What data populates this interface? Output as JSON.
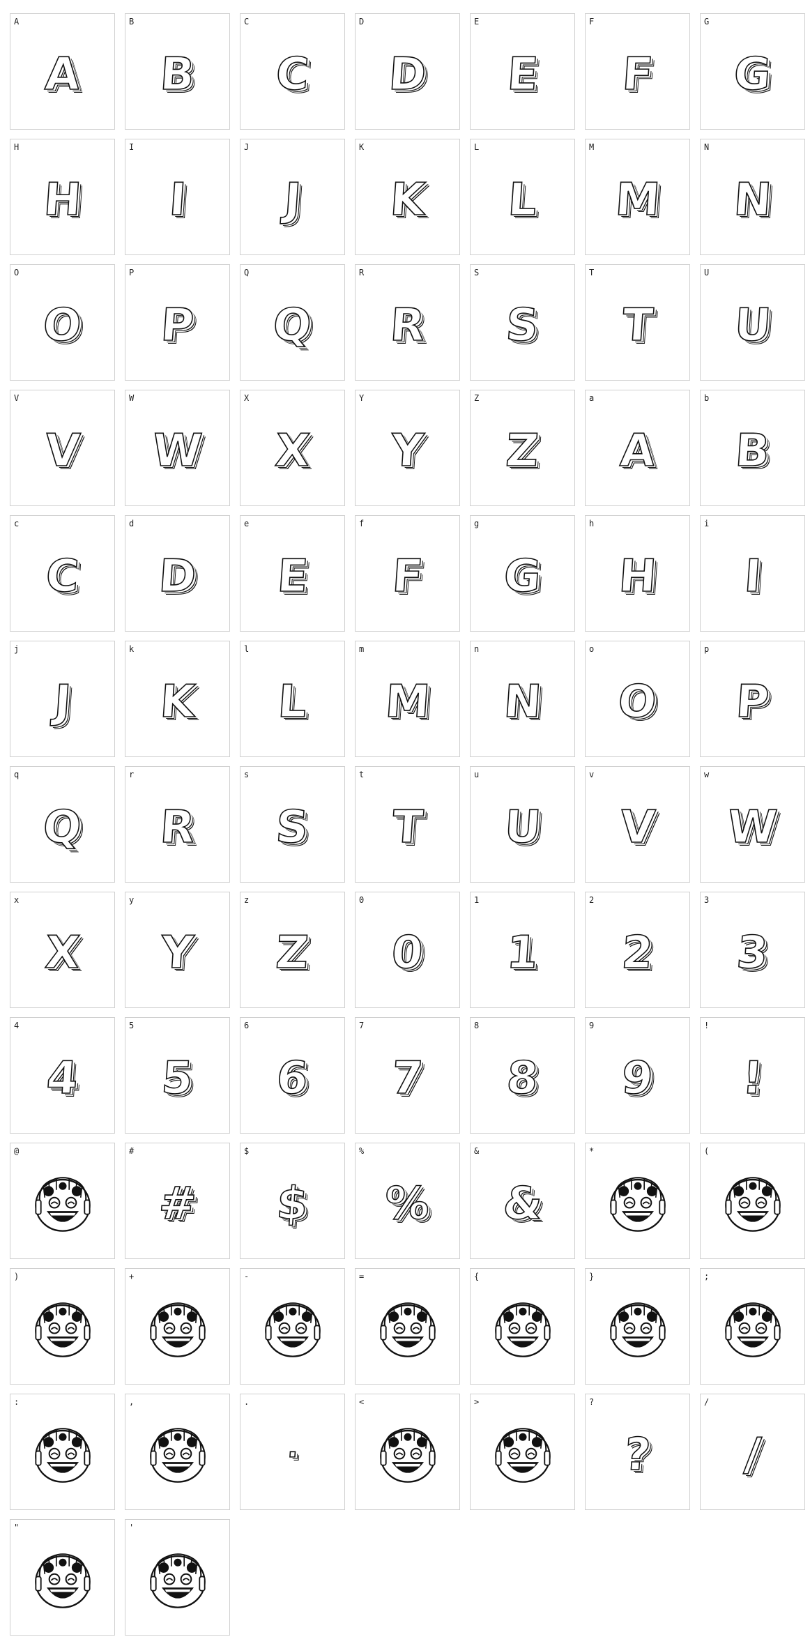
{
  "glyphs": [
    {
      "label": "A",
      "char": "A",
      "kind": "letter"
    },
    {
      "label": "B",
      "char": "B",
      "kind": "letter"
    },
    {
      "label": "C",
      "char": "C",
      "kind": "letter"
    },
    {
      "label": "D",
      "char": "D",
      "kind": "letter"
    },
    {
      "label": "E",
      "char": "E",
      "kind": "letter"
    },
    {
      "label": "F",
      "char": "F",
      "kind": "letter"
    },
    {
      "label": "G",
      "char": "G",
      "kind": "letter"
    },
    {
      "label": "H",
      "char": "H",
      "kind": "letter"
    },
    {
      "label": "I",
      "char": "I",
      "kind": "letter"
    },
    {
      "label": "J",
      "char": "J",
      "kind": "letter"
    },
    {
      "label": "K",
      "char": "K",
      "kind": "letter"
    },
    {
      "label": "L",
      "char": "L",
      "kind": "letter"
    },
    {
      "label": "M",
      "char": "M",
      "kind": "letter"
    },
    {
      "label": "N",
      "char": "N",
      "kind": "letter"
    },
    {
      "label": "O",
      "char": "O",
      "kind": "letter"
    },
    {
      "label": "P",
      "char": "P",
      "kind": "letter"
    },
    {
      "label": "Q",
      "char": "Q",
      "kind": "letter"
    },
    {
      "label": "R",
      "char": "R",
      "kind": "letter"
    },
    {
      "label": "S",
      "char": "S",
      "kind": "letter"
    },
    {
      "label": "T",
      "char": "T",
      "kind": "letter"
    },
    {
      "label": "U",
      "char": "U",
      "kind": "letter"
    },
    {
      "label": "V",
      "char": "V",
      "kind": "letter"
    },
    {
      "label": "W",
      "char": "W",
      "kind": "letter"
    },
    {
      "label": "X",
      "char": "X",
      "kind": "letter"
    },
    {
      "label": "Y",
      "char": "Y",
      "kind": "letter"
    },
    {
      "label": "Z",
      "char": "Z",
      "kind": "letter"
    },
    {
      "label": "a",
      "char": "A",
      "kind": "letter"
    },
    {
      "label": "b",
      "char": "B",
      "kind": "letter"
    },
    {
      "label": "c",
      "char": "C",
      "kind": "letter"
    },
    {
      "label": "d",
      "char": "D",
      "kind": "letter"
    },
    {
      "label": "e",
      "char": "E",
      "kind": "letter"
    },
    {
      "label": "f",
      "char": "F",
      "kind": "letter"
    },
    {
      "label": "g",
      "char": "G",
      "kind": "letter"
    },
    {
      "label": "h",
      "char": "H",
      "kind": "letter"
    },
    {
      "label": "i",
      "char": "I",
      "kind": "letter"
    },
    {
      "label": "j",
      "char": "J",
      "kind": "letter"
    },
    {
      "label": "k",
      "char": "K",
      "kind": "letter"
    },
    {
      "label": "l",
      "char": "L",
      "kind": "letter"
    },
    {
      "label": "m",
      "char": "M",
      "kind": "letter"
    },
    {
      "label": "n",
      "char": "N",
      "kind": "letter"
    },
    {
      "label": "o",
      "char": "O",
      "kind": "letter"
    },
    {
      "label": "p",
      "char": "P",
      "kind": "letter"
    },
    {
      "label": "q",
      "char": "Q",
      "kind": "letter"
    },
    {
      "label": "r",
      "char": "R",
      "kind": "letter"
    },
    {
      "label": "s",
      "char": "S",
      "kind": "letter"
    },
    {
      "label": "t",
      "char": "T",
      "kind": "letter"
    },
    {
      "label": "u",
      "char": "U",
      "kind": "letter"
    },
    {
      "label": "v",
      "char": "V",
      "kind": "letter"
    },
    {
      "label": "w",
      "char": "W",
      "kind": "letter"
    },
    {
      "label": "x",
      "char": "X",
      "kind": "letter"
    },
    {
      "label": "y",
      "char": "Y",
      "kind": "letter"
    },
    {
      "label": "z",
      "char": "Z",
      "kind": "letter"
    },
    {
      "label": "0",
      "char": "0",
      "kind": "digit"
    },
    {
      "label": "1",
      "char": "1",
      "kind": "digit"
    },
    {
      "label": "2",
      "char": "2",
      "kind": "digit"
    },
    {
      "label": "3",
      "char": "3",
      "kind": "digit"
    },
    {
      "label": "4",
      "char": "4",
      "kind": "digit"
    },
    {
      "label": "5",
      "char": "5",
      "kind": "digit"
    },
    {
      "label": "6",
      "char": "6",
      "kind": "digit"
    },
    {
      "label": "7",
      "char": "7",
      "kind": "digit"
    },
    {
      "label": "8",
      "char": "8",
      "kind": "digit"
    },
    {
      "label": "9",
      "char": "9",
      "kind": "digit"
    },
    {
      "label": "!",
      "char": "!",
      "kind": "symbol"
    },
    {
      "label": "@",
      "char": "",
      "kind": "face"
    },
    {
      "label": "#",
      "char": "#",
      "kind": "symbol"
    },
    {
      "label": "$",
      "char": "$",
      "kind": "symbol"
    },
    {
      "label": "%",
      "char": "%",
      "kind": "symbol"
    },
    {
      "label": "&",
      "char": "&",
      "kind": "symbol"
    },
    {
      "label": "*",
      "char": "",
      "kind": "face"
    },
    {
      "label": "(",
      "char": "",
      "kind": "face"
    },
    {
      "label": ")",
      "char": "",
      "kind": "face"
    },
    {
      "label": "+",
      "char": "",
      "kind": "face"
    },
    {
      "label": "-",
      "char": "",
      "kind": "face"
    },
    {
      "label": "=",
      "char": "",
      "kind": "face"
    },
    {
      "label": "{",
      "char": "",
      "kind": "face"
    },
    {
      "label": "}",
      "char": "",
      "kind": "face"
    },
    {
      "label": ";",
      "char": "",
      "kind": "face"
    },
    {
      "label": ":",
      "char": "",
      "kind": "face"
    },
    {
      "label": ",",
      "char": "",
      "kind": "face"
    },
    {
      "label": ".",
      "char": "·",
      "kind": "symbol"
    },
    {
      "label": "<",
      "char": "",
      "kind": "face"
    },
    {
      "label": ">",
      "char": "",
      "kind": "face"
    },
    {
      "label": "?",
      "char": "?",
      "kind": "symbol"
    },
    {
      "label": "/",
      "char": "/",
      "kind": "symbol"
    },
    {
      "label": "\"",
      "char": "",
      "kind": "face"
    },
    {
      "label": "'",
      "char": "",
      "kind": "face"
    }
  ]
}
